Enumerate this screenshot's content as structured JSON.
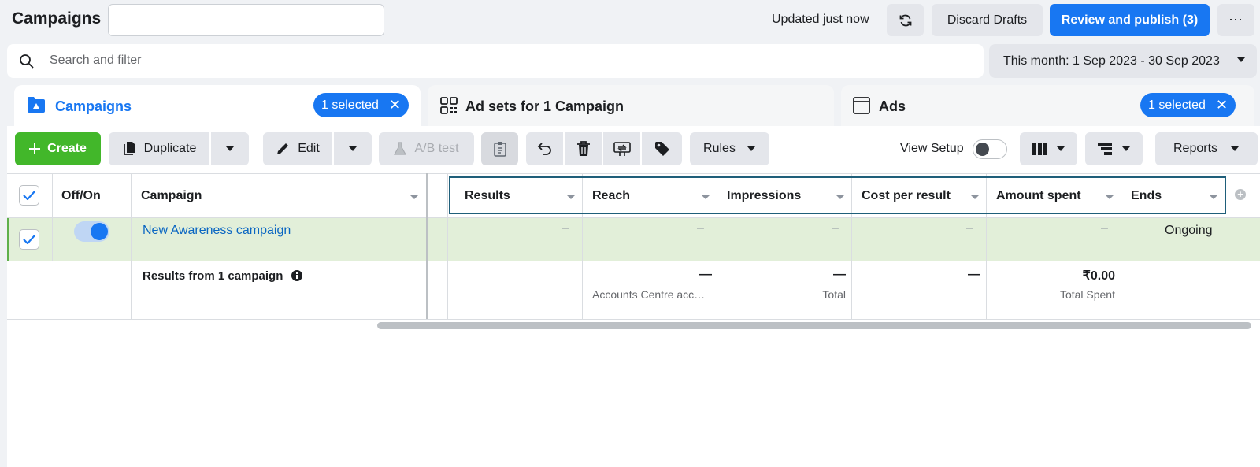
{
  "header": {
    "title": "Campaigns",
    "campaign_name_value": "",
    "updated_text": "Updated just now",
    "discard_label": "Discard Drafts",
    "publish_label": "Review and publish (3)",
    "more_label": "⋯"
  },
  "search": {
    "placeholder": "Search and filter",
    "date_range": "This month: 1 Sep 2023 - 30 Sep 2023"
  },
  "tabs": [
    {
      "label": "Campaigns",
      "badge": "1 selected",
      "icon": "folder-icon",
      "active": true
    },
    {
      "label": "Ad sets for 1 Campaign",
      "badge": "",
      "icon": "grid-icon",
      "active": false
    },
    {
      "label": "Ads",
      "badge": "1 selected",
      "icon": "window-icon",
      "active": false
    }
  ],
  "toolbar": {
    "create_label": "Create",
    "duplicate_label": "Duplicate",
    "edit_label": "Edit",
    "ab_test_label": "A/B test",
    "rules_label": "Rules",
    "view_setup_label": "View Setup",
    "view_setup_on": false,
    "reports_label": "Reports"
  },
  "table": {
    "columns": [
      "Off/On",
      "Campaign",
      "Results",
      "Reach",
      "Impressions",
      "Cost per result",
      "Amount spent",
      "Ends"
    ],
    "rows": [
      {
        "selected": true,
        "on": true,
        "campaign": "New Awareness campaign",
        "results": "–",
        "reach": "–",
        "impressions": "–",
        "cost_per_result": "–",
        "amount_spent": "–",
        "ends": "Ongoing"
      }
    ],
    "totals": {
      "label": "Results from 1 campaign",
      "reach": "—",
      "reach_sub": "Accounts Centre accounts",
      "impressions": "—",
      "impressions_sub": "Total",
      "cost_per_result": "—",
      "amount_spent": "₹0.00",
      "amount_spent_sub": "Total Spent"
    }
  },
  "colors": {
    "primary": "#1877f2",
    "create": "#42b72a",
    "selected_row": "#e2efd9",
    "highlight_border": "#1f5f7a"
  }
}
